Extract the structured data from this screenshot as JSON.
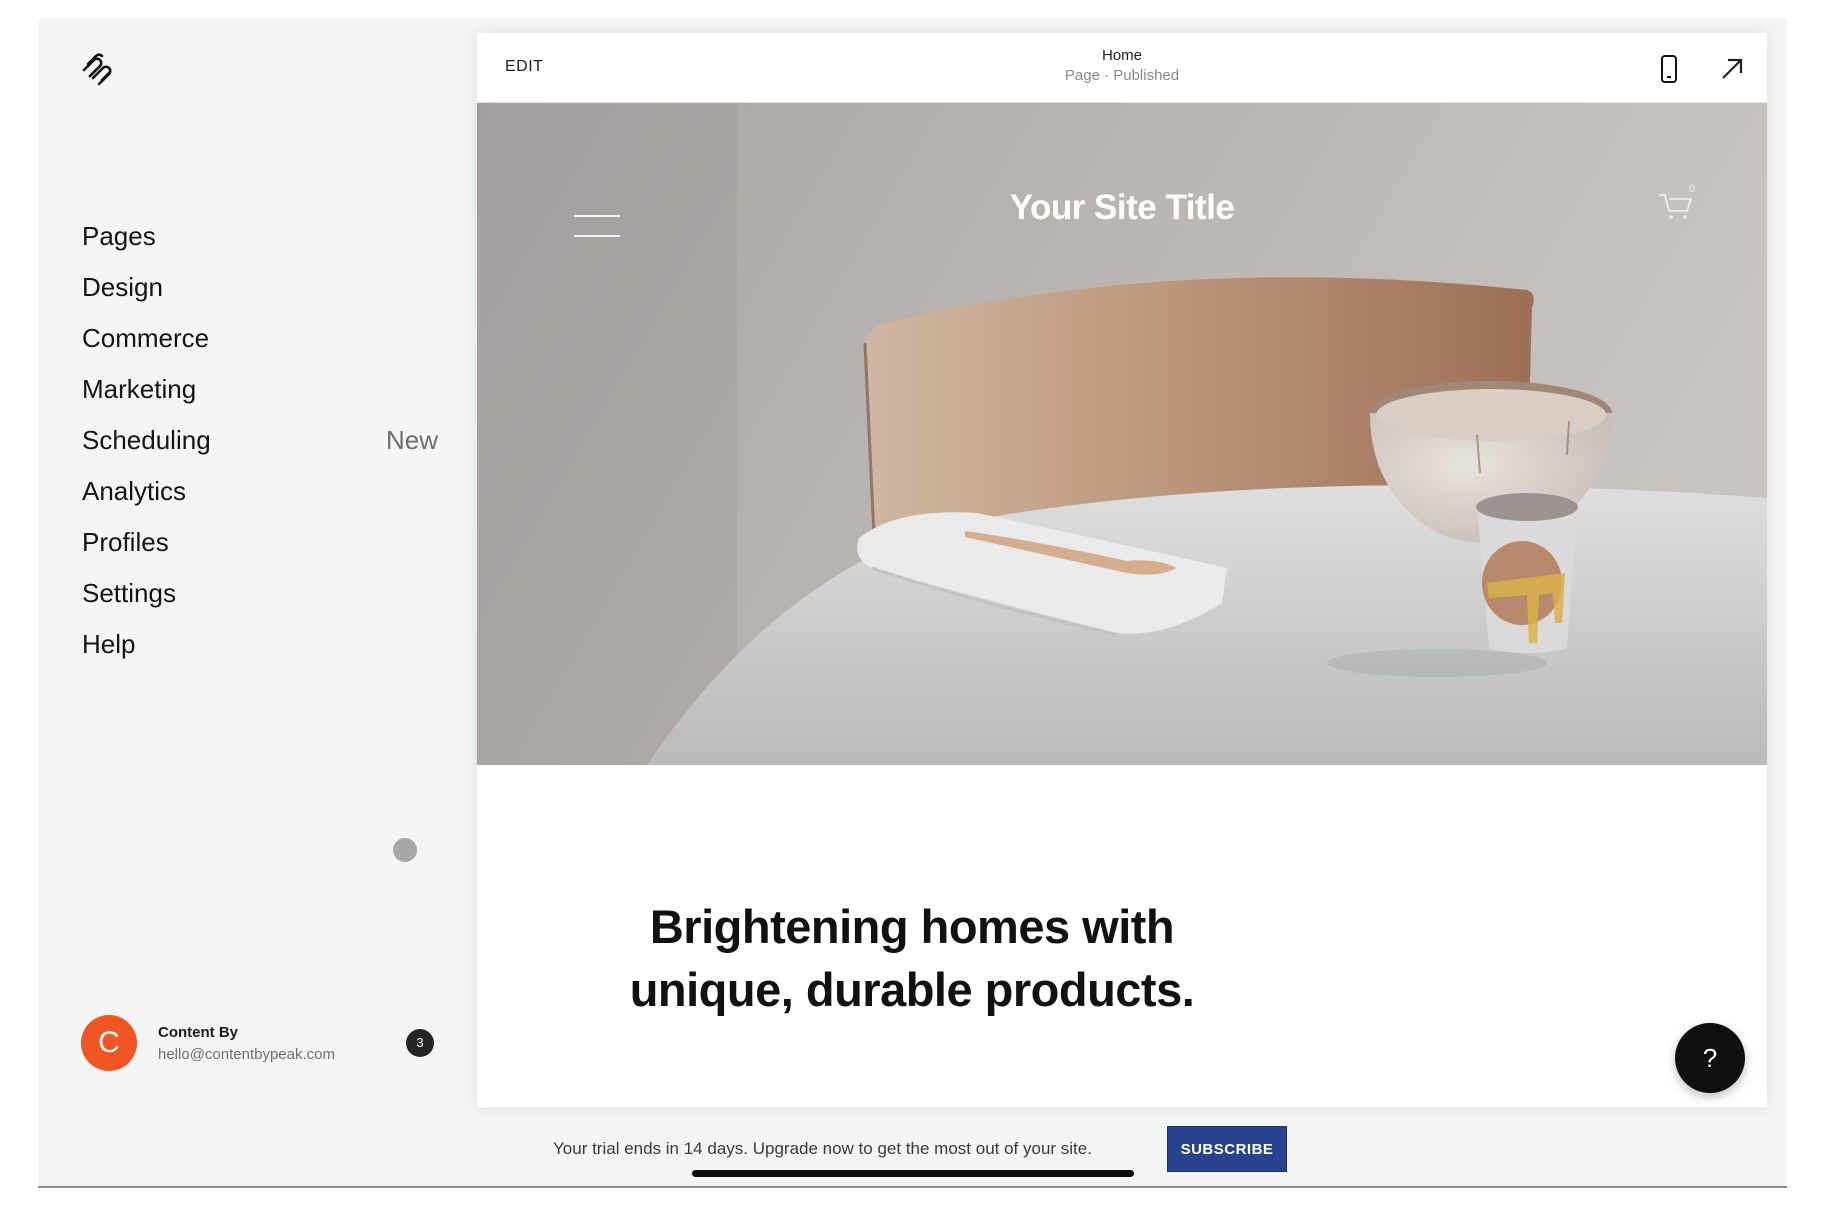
{
  "sidebar": {
    "logo": "squarespace-logo",
    "nav": [
      {
        "label": "Pages"
      },
      {
        "label": "Design"
      },
      {
        "label": "Commerce"
      },
      {
        "label": "Marketing"
      },
      {
        "label": "Scheduling",
        "badge": "New"
      },
      {
        "label": "Analytics"
      },
      {
        "label": "Profiles"
      },
      {
        "label": "Settings"
      },
      {
        "label": "Help"
      }
    ],
    "account": {
      "avatar_initial": "C",
      "avatar_color": "#ef5623",
      "name": "Content By",
      "email": "hello@contentbypeak.com",
      "notification_count": "3"
    }
  },
  "preview": {
    "topbar": {
      "edit_label": "EDIT",
      "page_name": "Home",
      "page_status": "Page · Published",
      "icons": [
        "mobile-view-icon",
        "open-external-icon"
      ]
    },
    "site": {
      "title": "Your Site Title",
      "cart_count": "0",
      "headline_line1": "Brightening homes with",
      "headline_line2": "unique, durable products."
    },
    "help_label": "?"
  },
  "trial_banner": {
    "text": "Your trial ends in 14 days. Upgrade now to get the most out of your site.",
    "button_label": "SUBSCRIBE",
    "button_color": "#27438f"
  }
}
